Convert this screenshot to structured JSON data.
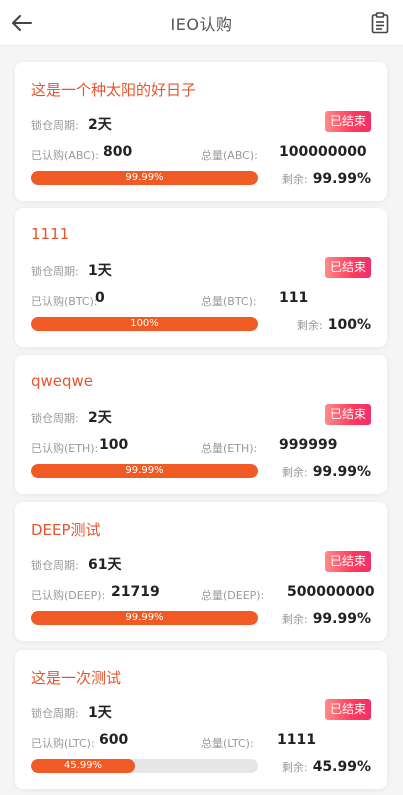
{
  "header": {
    "title": "IEO认购",
    "back_icon": "arrow-left-icon",
    "record_icon": "clipboard-icon"
  },
  "colors": {
    "accent": "#f05a24",
    "title_text": "#e8542c",
    "badge_gradient_start": "#ff8a8a",
    "badge_gradient_end": "#f0306a"
  },
  "labels": {
    "lock_period": "锁仓周期:",
    "remaining": "剩余:"
  },
  "projects": [
    {
      "name": "这是一个种太阳的好日子",
      "lock_period": "2天",
      "status": "已结束",
      "subscribed_label": "已认购(ABC):",
      "subscribed": "800",
      "total_label": "总量(ABC):",
      "total": "100000000",
      "progress_text": "99.99%",
      "progress": 1.0,
      "remaining": "99.99%"
    },
    {
      "name": "1111",
      "lock_period": "1天",
      "status": "已结束",
      "subscribed_label": "已认购(BTC):",
      "subscribed": "0",
      "total_label": "总量(BTC):",
      "total": "111",
      "progress_text": "100%",
      "progress": 1.0,
      "remaining": "100%"
    },
    {
      "name": "qweqwe",
      "lock_period": "2天",
      "status": "已结束",
      "subscribed_label": "已认购(ETH):",
      "subscribed": "100",
      "total_label": "总量(ETH):",
      "total": "999999",
      "progress_text": "99.99%",
      "progress": 1.0,
      "remaining": "99.99%"
    },
    {
      "name": "DEEP测试",
      "lock_period": "61天",
      "status": "已结束",
      "subscribed_label": "已认购(DEEP):",
      "subscribed": "21719",
      "total_label": "总量(DEEP):",
      "total": "500000000",
      "progress_text": "99.99%",
      "progress": 1.0,
      "remaining": "99.99%"
    },
    {
      "name": "这是一次测试",
      "lock_period": "1天",
      "status": "已结束",
      "subscribed_label": "已认购(LTC):",
      "subscribed": "600",
      "total_label": "总量(LTC):",
      "total": "1111",
      "progress_text": "45.99%",
      "progress": 0.4599,
      "remaining": "45.99%"
    }
  ]
}
